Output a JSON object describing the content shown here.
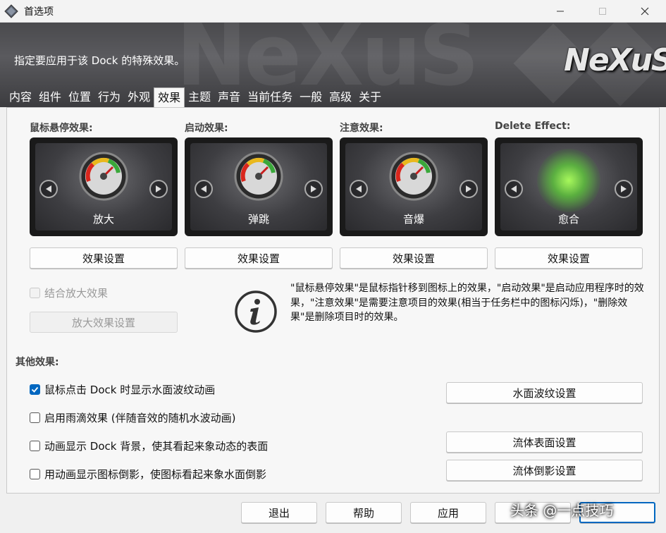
{
  "window": {
    "title": "首选项",
    "minimize": "—",
    "maximize": "☐",
    "close": "✕"
  },
  "banner": {
    "description": "指定要应用于该 Dock 的特殊效果。",
    "logo": "NeXuS",
    "bg_text": "NeXuS"
  },
  "tabs": [
    {
      "label": "内容",
      "active": false
    },
    {
      "label": "组件",
      "active": false
    },
    {
      "label": "位置",
      "active": false
    },
    {
      "label": "行为",
      "active": false
    },
    {
      "label": "外观",
      "active": false
    },
    {
      "label": "效果",
      "active": true
    },
    {
      "label": "主题",
      "active": false
    },
    {
      "label": "声音",
      "active": false
    },
    {
      "label": "当前任务",
      "active": false
    },
    {
      "label": "一般",
      "active": false
    },
    {
      "label": "高级",
      "active": false
    },
    {
      "label": "关于",
      "active": false
    }
  ],
  "effects": [
    {
      "label": "鼠标悬停效果:",
      "name": "放大",
      "button": "效果设置",
      "icon": "gauge-icon"
    },
    {
      "label": "启动效果:",
      "name": "弹跳",
      "button": "效果设置",
      "icon": "gauge-icon"
    },
    {
      "label": "注意效果:",
      "name": "音爆",
      "button": "效果设置",
      "icon": "gauge-icon"
    },
    {
      "label": "Delete Effect:",
      "name": "愈合",
      "button": "效果设置",
      "icon": "green-glow-icon"
    }
  ],
  "combine": {
    "label": "结合放大效果",
    "checked": false,
    "disabled": true,
    "settings_button": "放大效果设置"
  },
  "info": {
    "icon": "info-icon",
    "text": "\"鼠标悬停效果\"是鼠标指针移到图标上的效果，\"启动效果\"是启动应用程序时的效果，\"注意效果\"是需要注意项目的效果(相当于任务栏中的图标闪烁)，\"删除效果\"是删除项目时的效果。"
  },
  "other": {
    "label": "其他效果:",
    "options": [
      {
        "label": "鼠标点击 Dock 时显示水面波纹动画",
        "checked": true
      },
      {
        "label": "启用雨滴效果 (伴随音效的随机水波动画)",
        "checked": false
      },
      {
        "label": "动画显示 Dock 背景，使其看起来象动态的表面",
        "checked": false
      },
      {
        "label": "用动画显示图标倒影，使图标看起来象水面倒影",
        "checked": false
      }
    ],
    "buttons": {
      "ripple": "水面波纹设置",
      "fluid_surface": "流体表面设置",
      "fluid_reflection": "流体倒影设置"
    }
  },
  "footer": {
    "exit": "退出",
    "help": "帮助",
    "apply": "应用"
  },
  "watermark": "头条 @一点技巧",
  "colors": {
    "accent": "#0067c0",
    "banner": "#4a4a4d"
  }
}
